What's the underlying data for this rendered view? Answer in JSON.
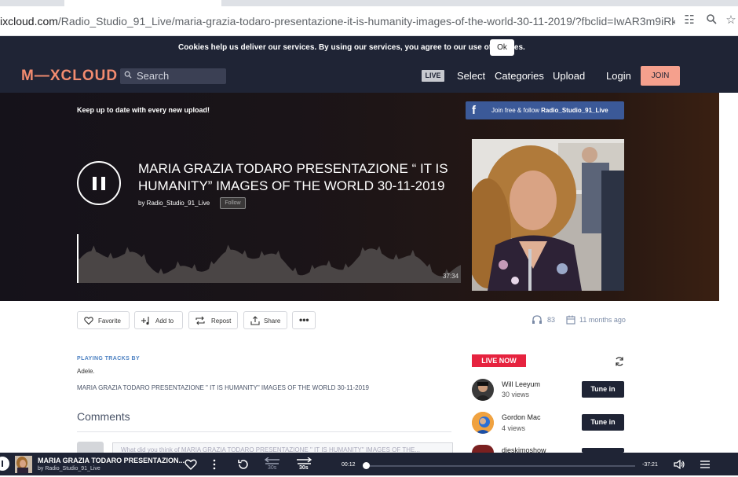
{
  "browser": {
    "url_host": "ixcloud.com",
    "url_path": "/Radio_Studio_91_Live/maria-grazia-todaro-presentazione-it-is-humanity-images-of-the-world-30-11-2019/?fbclid=IwAR3m9iRklan8ohtfpgNLZ4d..."
  },
  "cookie": {
    "message": "Cookies help us deliver our services. By using our services, you agree to our use of cookies.",
    "ok_label": "Ok"
  },
  "nav": {
    "logo": "M—XCLOUD",
    "search_label": "Search",
    "live_badge": "LIVE",
    "links": [
      "Select",
      "Categories",
      "Upload"
    ],
    "login": "Login",
    "join": "JOIN"
  },
  "hero": {
    "keep_up": "Keep up to date with every new upload!",
    "fb_prefix": "Join free & follow",
    "fb_user": "Radio_Studio_91_Live",
    "title": "MARIA GRAZIA TODARO PRESENTAZIONE “ IT IS HUMANITY” IMAGES OF THE WORLD 30-11-2019",
    "by_label": "by Radio_Studio_91_Live",
    "follow": "Follow",
    "duration": "37:34"
  },
  "actions": {
    "favorite": "Favorite",
    "add_to": "Add to",
    "repost": "Repost",
    "share": "Share",
    "plays": "83",
    "age": "11 months ago"
  },
  "tracks": {
    "heading": "PLAYING TRACKS BY",
    "artist": "Adele.",
    "track": "MARIA GRAZIA TODARO PRESENTAZIONE \" IT IS HUMANITY\" IMAGES OF THE WORLD 30-11-2019"
  },
  "comments": {
    "heading": "Comments",
    "placeholder": "What did you think of MARIA GRAZIA TODARO PRESENTAZIONE \" IT IS HUMANITY\" IMAGES OF THE..."
  },
  "live_now": {
    "badge": "LIVE NOW",
    "tune_in": "Tune in",
    "items": [
      {
        "name": "Will Leeyum",
        "views": "30 views"
      },
      {
        "name": "Gordon Mac",
        "views": "4 views"
      },
      {
        "name": "djeskimoshow",
        "views": ""
      }
    ]
  },
  "player": {
    "title": "MARIA GRAZIA TODARO PRESENTAZION...",
    "by": "by Radio_Studio_91_Live",
    "back": "30s",
    "fwd": "30s",
    "elapsed": "00:12",
    "remaining": "-37:21",
    "progress": 0.005
  },
  "colors": {
    "nav_bg": "#1f2435",
    "accent": "#f5a08d",
    "live_red": "#e6233f",
    "fb_blue": "#3b5998"
  }
}
